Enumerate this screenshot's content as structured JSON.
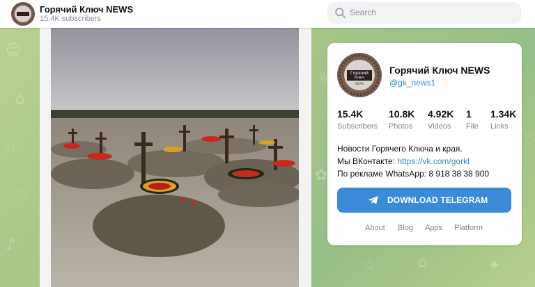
{
  "header": {
    "title": "Горячий Ключ NEWS",
    "subtitle": "15.4K subscribers",
    "search_placeholder": "Search"
  },
  "channel_card": {
    "title": "Горячий Ключ NEWS",
    "handle": "@gk_news1",
    "avatar_text": [
      "Горячий",
      "Ключ",
      "NEWS"
    ],
    "stats": [
      {
        "value": "15.4K",
        "label": "Subscribers"
      },
      {
        "value": "10.8K",
        "label": "Photos"
      },
      {
        "value": "4.92K",
        "label": "Videos"
      },
      {
        "value": "1",
        "label": "File"
      },
      {
        "value": "1.34K",
        "label": "Links"
      }
    ],
    "description": {
      "line1": "Новости Горячего Ключа и края.",
      "line2_prefix": "Мы ВКонтакте: ",
      "line2_link": "https://vk.com/gorkl",
      "line3": "По рекламе WhatsApp: 8 918 38 38 900"
    },
    "download_button": "DOWNLOAD TELEGRAM",
    "footer_links": [
      "About",
      "Blog",
      "Apps",
      "Platform"
    ]
  },
  "colors": {
    "accent": "#3b8bd9",
    "link": "#3c88c6",
    "background": "#a9c58a"
  },
  "icons": {
    "search": "search-icon",
    "telegram": "telegram-plane-icon"
  }
}
